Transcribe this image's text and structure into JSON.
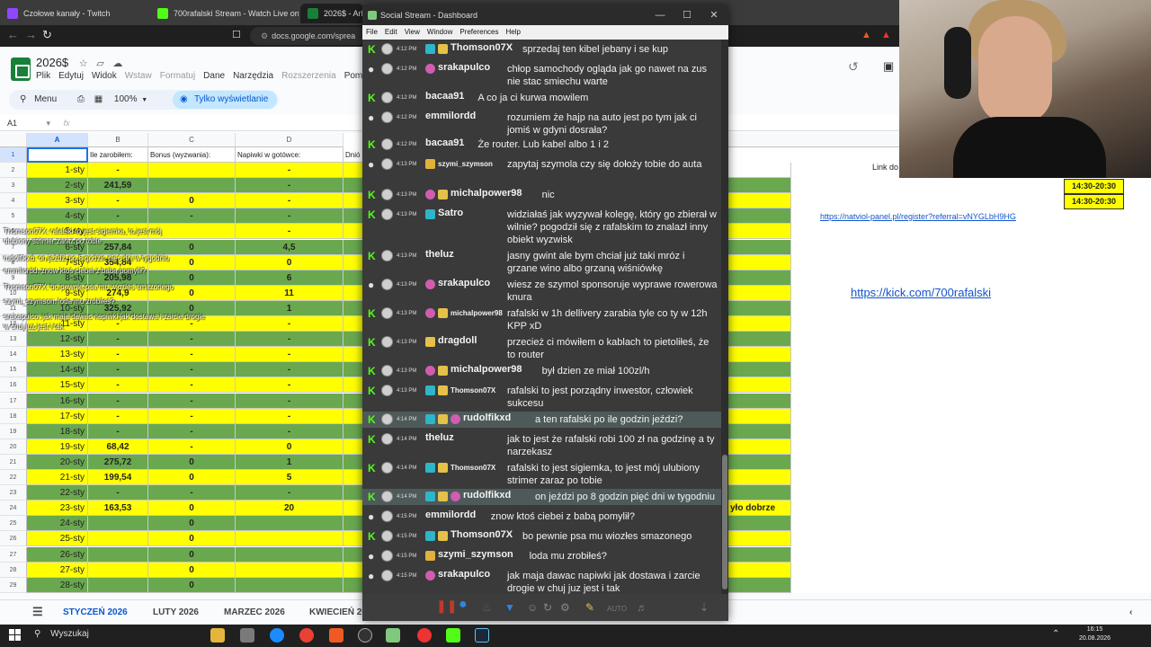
{
  "browser": {
    "tabs": [
      {
        "label": "Czołowe kanały - Twitch",
        "color": "#9146ff"
      },
      {
        "label": "700rafalski Stream - Watch Live on K",
        "color": "#53fc18"
      },
      {
        "label": "2026$ - Arku",
        "color": "#188038"
      }
    ],
    "url": "docs.google.com/sprea"
  },
  "sheet": {
    "title": "2026$",
    "menu": [
      "Plik",
      "Edytuj",
      "Widok",
      "Wstaw",
      "Formatuj",
      "Dane",
      "Narzędzia",
      "Rozszerzenia",
      "Pom"
    ],
    "menu_dim": [
      false,
      false,
      false,
      true,
      true,
      false,
      false,
      true,
      false
    ],
    "search_label": "Menu",
    "zoom": "100%",
    "view_only": "Tylko wyświetlanie",
    "name_box": "A1",
    "col_headers": [
      "A",
      "B",
      "C",
      "D"
    ],
    "header_row": {
      "A": "",
      "B": "Ile zarobiłem:",
      "C": "Bonus (wyzwania):",
      "D": "Napiwki w gotówce:",
      "E": "Dnió"
    },
    "rows": [
      {
        "n": "2",
        "A": "1-sty",
        "B": "-",
        "C": "",
        "D": "-",
        "color": "yel"
      },
      {
        "n": "3",
        "A": "2-sty",
        "B": "241,59",
        "C": "",
        "D": "-",
        "color": "grn"
      },
      {
        "n": "4",
        "A": "3-sty",
        "B": "-",
        "C": "0",
        "D": "-",
        "color": "yel"
      },
      {
        "n": "5",
        "A": "4-sty",
        "B": "-",
        "C": "-",
        "D": "-",
        "color": "grn"
      },
      {
        "n": "6",
        "A": "5-sty",
        "B": "",
        "C": "",
        "D": "-",
        "color": "yel"
      },
      {
        "n": "7",
        "A": "6-sty",
        "B": "257,84",
        "C": "0",
        "D": "4,5",
        "color": "grn"
      },
      {
        "n": "8",
        "A": "7-sty",
        "B": "354,84",
        "C": "0",
        "D": "0",
        "color": "yel"
      },
      {
        "n": "9",
        "A": "8-sty",
        "B": "205,98",
        "C": "0",
        "D": "6",
        "color": "grn"
      },
      {
        "n": "10",
        "A": "9-sty",
        "B": "274,9",
        "C": "0",
        "D": "11",
        "color": "yel"
      },
      {
        "n": "11",
        "A": "10-sty",
        "B": "325,92",
        "C": "0",
        "D": "1",
        "color": "grn"
      },
      {
        "n": "12",
        "A": "11-sty",
        "B": "-",
        "C": "-",
        "D": "-",
        "color": "yel"
      },
      {
        "n": "13",
        "A": "12-sty",
        "B": "-",
        "C": "-",
        "D": "-",
        "color": "grn"
      },
      {
        "n": "14",
        "A": "13-sty",
        "B": "-",
        "C": "-",
        "D": "-",
        "color": "yel"
      },
      {
        "n": "15",
        "A": "14-sty",
        "B": "-",
        "C": "-",
        "D": "-",
        "color": "grn"
      },
      {
        "n": "16",
        "A": "15-sty",
        "B": "-",
        "C": "-",
        "D": "-",
        "color": "yel"
      },
      {
        "n": "17",
        "A": "16-sty",
        "B": "-",
        "C": "-",
        "D": "-",
        "color": "grn"
      },
      {
        "n": "18",
        "A": "17-sty",
        "B": "-",
        "C": "-",
        "D": "-",
        "color": "yel"
      },
      {
        "n": "19",
        "A": "18-sty",
        "B": "-",
        "C": "-",
        "D": "-",
        "color": "grn"
      },
      {
        "n": "20",
        "A": "19-sty",
        "B": "68,42",
        "C": "-",
        "D": "0",
        "color": "yel"
      },
      {
        "n": "21",
        "A": "20-sty",
        "B": "275,72",
        "C": "0",
        "D": "1",
        "color": "grn"
      },
      {
        "n": "22",
        "A": "21-sty",
        "B": "199,54",
        "C": "0",
        "D": "5",
        "color": "yel"
      },
      {
        "n": "23",
        "A": "22-sty",
        "B": "-",
        "C": "-",
        "D": "-",
        "color": "grn"
      },
      {
        "n": "24",
        "A": "23-sty",
        "B": "163,53",
        "C": "0",
        "D": "20",
        "color": "yel"
      },
      {
        "n": "25",
        "A": "24-sty",
        "B": "",
        "C": "0",
        "D": "",
        "color": "grn"
      },
      {
        "n": "26",
        "A": "25-sty",
        "B": "",
        "C": "0",
        "D": "",
        "color": "yel"
      },
      {
        "n": "27",
        "A": "26-sty",
        "B": "",
        "C": "0",
        "D": "",
        "color": "grn"
      },
      {
        "n": "28",
        "A": "27-sty",
        "B": "",
        "C": "0",
        "D": "",
        "color": "yel"
      },
      {
        "n": "29",
        "A": "28-sty",
        "B": "",
        "C": "0",
        "D": "",
        "color": "grn"
      }
    ],
    "right_col": {
      "link_label": "Link do",
      "r24": "yło dobrze"
    },
    "times": [
      "14:30-20:30",
      "14:30-20:30"
    ],
    "ref_link": "https://natviol-panel.pl/register?referral=vNYGLbH9HG",
    "kick_link": "https://kick.com/700rafalski",
    "sheet_tabs": [
      "STYCZEŃ 2026",
      "LUTY 2026",
      "MARZEC 2026",
      "KWIECIEŃ 20"
    ]
  },
  "overlay": [
    "Thomson07X: rafalski to jest sigiemka, to jest mój",
    "ulubiony strimer zaraz po tobie",
    "rudolfikxd: on jeździ po 8 godzin pięć dni w tygodniu",
    "emmilordd: znow ktoś ciebei z babą pomylił?",
    "Thomson07X: bo pewnie psa mu wiozłes smazonego",
    "szymi_szymson: loda mu zrobiłeś?",
    "srakapulco: jak maja dawac napiwki jak dostawa i zarcie drogie",
    "w chuj juz jest i tak"
  ],
  "social_stream": {
    "title": "Social Stream - Dashboard",
    "menu": [
      "File",
      "Edit",
      "View",
      "Window",
      "Preferences",
      "Help"
    ],
    "messages": [
      {
        "time": "4:12 PM",
        "user": "Thomson07X",
        "text": "sprzedaj ten kibel jebany i se kup",
        "badges": [
          "mod",
          "vip"
        ],
        "plat": "kick",
        "small": false
      },
      {
        "time": "4:12 PM",
        "user": "srakapulco",
        "text": "chłop samochody ogląda jak go nawet na zus nie stac smiechu warte",
        "badges": [
          "sub"
        ],
        "plat": "yt",
        "small": false
      },
      {
        "time": "4:12 PM",
        "user": "bacaa91",
        "text": "A co ja ci kurwa mowilem",
        "badges": [],
        "plat": "kick",
        "small": false
      },
      {
        "time": "4:12 PM",
        "user": "emmilordd",
        "text": "rozumiem że hajp na auto jest po tym jak ci jomiś w gdyni dosrała?",
        "badges": [],
        "plat": "yt",
        "small": false
      },
      {
        "time": "4:12 PM",
        "user": "bacaa91",
        "text": "Że router. Lub kabel albo 1 i 2",
        "badges": [],
        "plat": "kick",
        "small": false
      },
      {
        "time": "4:13 PM",
        "user": "szymi_szymson",
        "text": "zapytaj szymola czy się dołoży tobie do auta",
        "badges": [
          "yt"
        ],
        "plat": "yt",
        "small": true
      },
      {
        "time": "4:13 PM",
        "user": "michalpower98",
        "text": "nic",
        "badges": [
          "sub",
          "vip"
        ],
        "plat": "kick",
        "small": false
      },
      {
        "time": "4:13 PM",
        "user": "Satro",
        "text": "widziałaś jak wyzywał kolegę, który go zbierał w wilnie? pogodził się z rafalskim to znalazł inny obiekt wyzwisk",
        "badges": [
          "mod"
        ],
        "plat": "kick",
        "small": false
      },
      {
        "time": "4:13 PM",
        "user": "theluz",
        "text": "jasny gwint ale bym chciał już taki mróz i grzane wino albo grzaną wiśniówkę",
        "badges": [],
        "plat": "kick",
        "small": false
      },
      {
        "time": "4:13 PM",
        "user": "srakapulco",
        "text": "wiesz ze szymol sponsoruje wyprawe rowerowa knura",
        "badges": [
          "sub"
        ],
        "plat": "yt",
        "small": false
      },
      {
        "time": "4:13 PM",
        "user": "michalpower98",
        "text": "rafalski w 1h dellivery zarabia tyle co ty w 12h KPP xD",
        "badges": [
          "sub",
          "vip"
        ],
        "plat": "kick",
        "small": true
      },
      {
        "time": "4:13 PM",
        "user": "dragdoll",
        "text": "przecież ci mówiłem o kablach to pietoliłeś, że to router",
        "badges": [
          "vip"
        ],
        "plat": "kick",
        "small": false
      },
      {
        "time": "4:13 PM",
        "user": "michalpower98",
        "text": "był dzien ze miał 100zl/h",
        "badges": [
          "sub",
          "vip"
        ],
        "plat": "kick",
        "small": false
      },
      {
        "time": "4:13 PM",
        "user": "Thomson07X",
        "text": "rafalski to jest porządny inwestor, człowiek sukcesu",
        "badges": [
          "mod",
          "vip"
        ],
        "plat": "kick",
        "small": true
      },
      {
        "time": "4:14 PM",
        "user": "rudolfikxd",
        "text": "a ten rafalski po ile godzin jeździ?",
        "badges": [
          "mod",
          "vip",
          "sub"
        ],
        "plat": "kick",
        "small": false
      },
      {
        "time": "4:14 PM",
        "user": "theluz",
        "text": "jak to jest że rafalski robi 100 zł na godzinę a ty narzekasz",
        "badges": [],
        "plat": "kick",
        "small": false
      },
      {
        "time": "4:14 PM",
        "user": "Thomson07X",
        "text": "rafalski to jest sigiemka, to jest mój ulubiony strimer zaraz po tobie",
        "badges": [
          "mod",
          "vip"
        ],
        "plat": "kick",
        "small": true
      },
      {
        "time": "4:14 PM",
        "user": "rudolfikxd",
        "text": "on jeździ po 8 godzin pięć dni w tygodniu",
        "badges": [
          "mod",
          "vip",
          "sub"
        ],
        "plat": "kick",
        "small": false
      },
      {
        "time": "4:15 PM",
        "user": "emmilordd",
        "text": "znow ktoś ciebei z babą pomylił?",
        "badges": [],
        "plat": "yt",
        "small": false
      },
      {
        "time": "4:15 PM",
        "user": "Thomson07X",
        "text": "bo pewnie psa mu wiozłes smazonego",
        "badges": [
          "mod",
          "vip"
        ],
        "plat": "kick",
        "small": false
      },
      {
        "time": "4:15 PM",
        "user": "szymi_szymson",
        "text": "loda mu zrobiłeś?",
        "badges": [
          "yt"
        ],
        "plat": "yt",
        "small": false
      },
      {
        "time": "4:15 PM",
        "user": "srakapulco",
        "text": "jak maja dawac napiwki jak dostawa i zarcie drogie w chuj juz jest i tak",
        "badges": [
          "sub"
        ],
        "plat": "yt",
        "small": false
      }
    ]
  },
  "taskbar": {
    "search": "Wyszukaj",
    "time": "16:15",
    "date": "20.08.2026"
  }
}
